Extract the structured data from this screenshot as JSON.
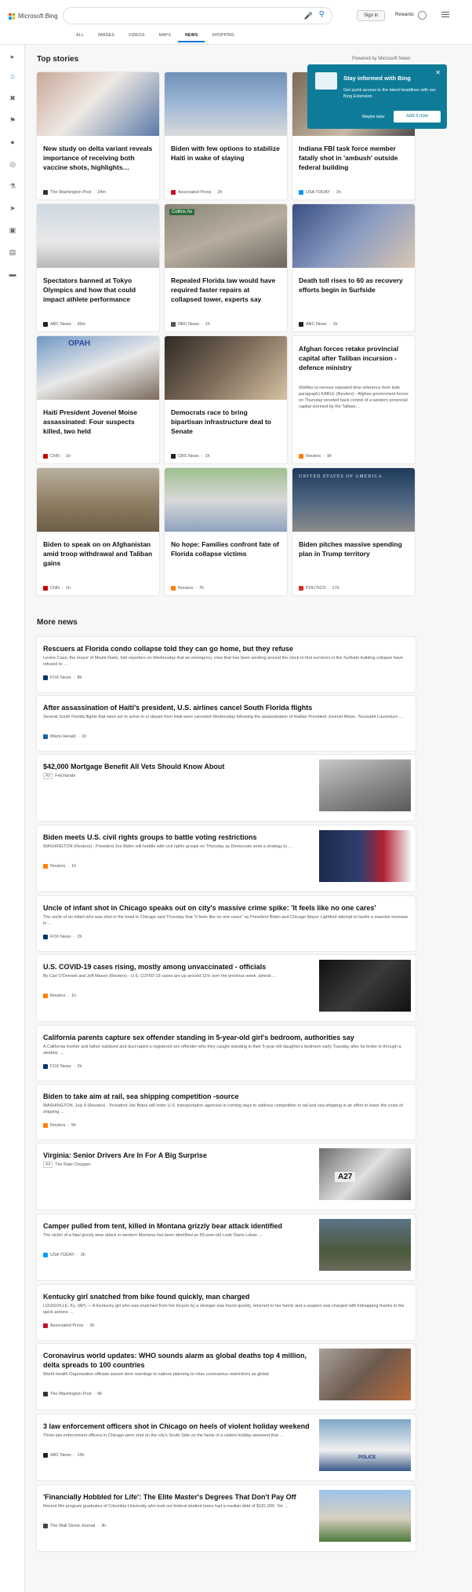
{
  "header": {
    "logo_text": "Microsoft Bing",
    "search_placeholder": "",
    "signin_label": "Sign in",
    "rewards_label": "Rewards",
    "scopes": [
      "ALL",
      "IMAGES",
      "VIDEOS",
      "MAPS",
      "NEWS",
      "SHOPPING"
    ],
    "active_scope": "NEWS"
  },
  "colors": {
    "accent": "#1a73d9",
    "promo_bg": "#0e7c99"
  },
  "rail": {
    "icons": [
      "expand-icon",
      "home-icon",
      "crossed-tools-icon",
      "flag-icon",
      "location-pin-icon",
      "globe-icon",
      "microscope-icon",
      "rocket-icon",
      "film-icon",
      "bank-icon",
      "card-icon"
    ]
  },
  "top_stories": {
    "title": "Top stories",
    "powered_by": "Powered by Microsoft News",
    "cards": [
      {
        "title": "New study on delta variant reveals importance of receiving both vaccine shots, highlights…",
        "source": "The Washington Post",
        "time": "24m"
      },
      {
        "title": "Biden with few options to stabilize Haiti in wake of slaying",
        "source": "Associated Press",
        "time": "2h"
      },
      {
        "title": "Indiana FBI task force member fatally shot in 'ambush' outside federal building",
        "source": "USA TODAY",
        "time": "1h"
      },
      {
        "title": "Spectators banned at Tokyo Olympics and how that could impact athlete performance",
        "source": "ABC News",
        "time": "36m"
      },
      {
        "title": "Repealed Florida law would have required faster repairs at collapsed tower, experts say",
        "source": "NBC News",
        "time": "1h"
      },
      {
        "title": "Death toll rises to 60 as recovery efforts begin in Surfside",
        "source": "ABC News",
        "time": "1h"
      },
      {
        "title": "Haiti President Jovenel Moise assassinated: Four suspects killed, two held",
        "source": "CNN",
        "time": "1h"
      },
      {
        "title": "Democrats race to bring bipartisan infrastructure deal to Senate",
        "source": "CBS News",
        "time": "1h"
      },
      {
        "title": "Afghan forces retake provincial capital after Taliban incursion - defence ministry",
        "snippet": "(Refiles to remove repeated time reference from lede paragraph) KABUL (Reuters) - Afghan government forces on Thursday wrested back control of a western provincial capital stormed by the Taliban…",
        "source": "Reuters",
        "time": "9h"
      },
      {
        "title": "Biden to speak on on Afghanistan amid troop withdrawal and Taliban gains",
        "source": "CNN",
        "time": "1h"
      },
      {
        "title": "No hope: Families confront fate of Florida collapse victims",
        "source": "Reuters",
        "time": "7h"
      },
      {
        "title": "Biden pitches massive spending plan in Trump territory",
        "source": "POLITICO",
        "time": "17h"
      }
    ],
    "photo_labels": {
      "collins_sign": "Collins Av",
      "opah_sign": "OPAH",
      "plane_text": "UNITED STATES OF AMERICA"
    }
  },
  "promo": {
    "title": "Stay informed with Bing",
    "text": "Get quick access to the latest headlines with our Bing Extension",
    "maybe_later": "Maybe later",
    "add_now": "Add it now"
  },
  "more_news": {
    "title": "More news",
    "items": [
      {
        "title": "Rescuers at Florida condo collapse told they can go home, but they refuse",
        "snippet": "Levine Cava, the mayor of Miami-Dade, told reporters on Wednesday that an emergency crew that has been working around the clock to find survivors in the Surfside building collapse have refused to …",
        "source": "FOX News",
        "time": "8h"
      },
      {
        "title": "After assassination of Haiti's president, U.S. airlines cancel South Florida flights",
        "snippet": "Several South Florida flights that were set to arrive in or depart from Haiti were canceled Wednesday following the assassination of Haitian President Jovenel Moise. Toussaint Louverture …",
        "source": "Miami Herald",
        "time": "1h"
      },
      {
        "title": "$42,000 Mortgage Benefit All Vets Should Know About",
        "ad": "Ad",
        "source": "Fetcharate"
      },
      {
        "title": "Biden meets U.S. civil rights groups to battle voting restrictions",
        "snippet": "WASHINGTON (Reuters) - President Joe Biden will huddle with civil rights groups on Thursday as Democrats seek a strategy to …",
        "source": "Reuters",
        "time": "1h"
      },
      {
        "title": "Uncle of infant shot in Chicago speaks out on city's massive crime spike: 'It feels like no one cares'",
        "snippet": "The uncle of an infant who was shot in the head in Chicago said Thursday that \"it feels like no one cares\" as President Biden and Chicago Mayor Lightfoot attempt to tackle a massive increase in …",
        "source": "FOX News",
        "time": "2h"
      },
      {
        "title": "U.S. COVID-19 cases rising, mostly among unvaccinated - officials",
        "snippet": "By Carl O'Donnell and Jeff Mason (Reuters) - U.S. COVID-19 cases are up around 11% over the previous week, almost …",
        "source": "Reuters",
        "time": "1h"
      },
      {
        "title": "California parents capture sex offender standing in 5-year-old girl's bedroom, authorities say",
        "snippet": "A California mother and father subdued and duct-taped a registered sex offender who they caught standing in their 5-year-old daughter's bedroom early Tuesday after he broke in through a window, …",
        "source": "FOX News",
        "time": "2h"
      },
      {
        "title": "Biden to take aim at rail, sea shipping competition -source",
        "snippet": "WASHINGTON, July 8 (Reuters) - President Joe Biden will order U.S. transportation agencies in coming days to address competition in rail and sea shipping in an effort to lower the costs of shipping …",
        "source": "Reuters",
        "time": "5h"
      },
      {
        "title": "Virginia: Senior Drivers Are In For A Big Surprise",
        "ad": "Ad",
        "source": "The Rate Chopper"
      },
      {
        "title": "Camper pulled from tent, killed in Montana grizzly bear attack identified",
        "snippet": "The victim of a fatal grizzly bear attack in western Montana has been identified as 65-year-old Leah Davis Lokan …",
        "source": "USA TODAY",
        "time": "3h"
      },
      {
        "title": "Kentucky girl snatched from bike found quickly, man charged",
        "snippet": "LOUISVILLE, Ky. (AP) — A Kentucky girl who was snatched from her bicycle by a stranger was found quickly, returned to her family and a suspect was charged with kidnapping thanks to the quick actions …",
        "source": "Associated Press",
        "time": "3h"
      },
      {
        "title": "Coronavirus world updates: WHO sounds alarm as global deaths top 4 million, delta spreads to 100 countries",
        "snippet": "World Health Organization officials issued stern warnings to nations planning to relax coronavirus restrictions as global",
        "source": "The Washington Post",
        "time": "9h"
      },
      {
        "title": "3 law enforcement officers shot in Chicago on heels of violent holiday weekend",
        "snippet": "Three law enforcement officers in Chicago were shot on the city's South Side on the heels of a violent holiday weekend that …",
        "source": "ABC News",
        "time": "15h"
      },
      {
        "title": "'Financially Hobbled for Life': The Elite Master's Degrees That Don't Pay Off",
        "snippet": "Recent film program graduates of Columbia University who took out federal student loans had a median debt of $181,000. Yet …",
        "source": "The Wall Street Journal",
        "time": "3h"
      }
    ],
    "thumb_labels": {
      "plate_text": "A27",
      "police_text": "POLICE"
    }
  }
}
